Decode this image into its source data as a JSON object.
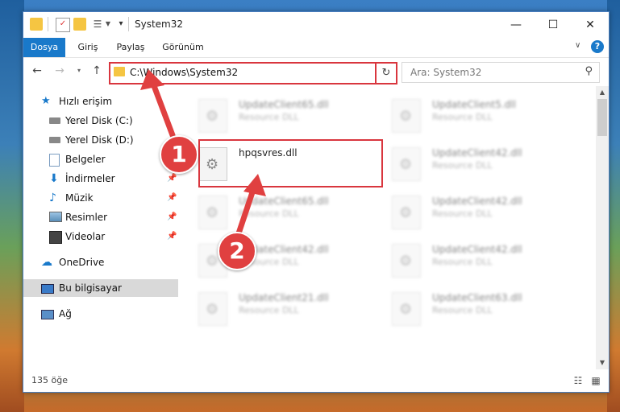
{
  "window": {
    "title": "System32",
    "controls": {
      "minimize": "—",
      "maximize": "☐",
      "close": "✕"
    }
  },
  "ribbon": {
    "tabs": [
      "Dosya",
      "Giriş",
      "Paylaş",
      "Görünüm"
    ],
    "active_tab": "Dosya",
    "help": "?"
  },
  "navbar": {
    "address": "C:\\Windows\\System32",
    "search_placeholder": "Ara: System32"
  },
  "sidebar": {
    "items": [
      {
        "label": "Hızlı erişim",
        "icon": "star-icon"
      },
      {
        "label": "Yerel Disk (C:)",
        "icon": "drive-icon",
        "pinned": true
      },
      {
        "label": "Yerel Disk (D:)",
        "icon": "drive-icon",
        "pinned": true
      },
      {
        "label": "Belgeler",
        "icon": "documents-icon",
        "pinned": true
      },
      {
        "label": "İndirmeler",
        "icon": "download-icon",
        "pinned": true
      },
      {
        "label": "Müzik",
        "icon": "music-icon",
        "pinned": true
      },
      {
        "label": "Resimler",
        "icon": "pictures-icon",
        "pinned": true
      },
      {
        "label": "Videolar",
        "icon": "video-icon",
        "pinned": true
      },
      {
        "label": "OneDrive",
        "icon": "cloud-icon"
      },
      {
        "label": "Bu bilgisayar",
        "icon": "computer-icon",
        "selected": true
      },
      {
        "label": "Ağ",
        "icon": "network-icon"
      }
    ]
  },
  "files": [
    {
      "name": "UpdateClient65.dll",
      "type": "Resource DLL",
      "blurred": true
    },
    {
      "name": "UpdateClient5.dll",
      "type": "Resource DLL",
      "blurred": true
    },
    {
      "name": "hpqsvres.dll",
      "type": "",
      "blurred": false
    },
    {
      "name": "UpdateClient42.dll",
      "type": "Resource DLL",
      "blurred": true
    },
    {
      "name": "UpdateClient65.dll",
      "type": "Resource DLL",
      "blurred": true
    },
    {
      "name": "UpdateClient42.dll",
      "type": "Resource DLL",
      "blurred": true
    },
    {
      "name": "UpdateClient42.dll",
      "type": "Resource DLL",
      "blurred": true
    },
    {
      "name": "UpdateClient42.dll",
      "type": "Resource DLL",
      "blurred": true
    },
    {
      "name": "UpdateClient21.dll",
      "type": "Resource DLL",
      "blurred": true
    },
    {
      "name": "UpdateClient63.dll",
      "type": "Resource DLL",
      "blurred": true
    }
  ],
  "status": {
    "count": "135 öğe"
  },
  "annotations": {
    "callout1": "1",
    "callout2": "2",
    "color": "#e04040"
  },
  "colors": {
    "accent": "#1979ca",
    "highlight": "#d9363e"
  }
}
